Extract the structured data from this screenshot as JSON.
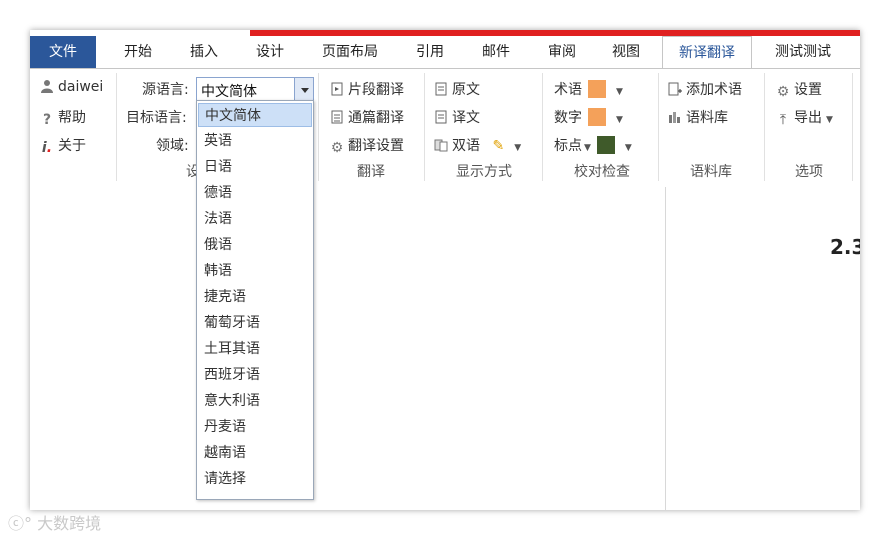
{
  "tabs": [
    "文件",
    "开始",
    "插入",
    "设计",
    "页面布局",
    "引用",
    "邮件",
    "审阅",
    "视图",
    "新译翻译",
    "测试测试"
  ],
  "user": {
    "name": "daiwei",
    "help": "帮助",
    "about": "关于"
  },
  "lang": {
    "source_label": "源语言:",
    "target_label": "目标语言:",
    "domain_label": "领域:",
    "source_value": "中文简体",
    "group_label_partial": "设",
    "options": [
      "中文简体",
      "英语",
      "日语",
      "德语",
      "法语",
      "俄语",
      "韩语",
      "捷克语",
      "葡萄牙语",
      "土耳其语",
      "西班牙语",
      "意大利语",
      "丹麦语",
      "越南语",
      "请选择"
    ]
  },
  "translate": {
    "fragment": "片段翻译",
    "full": "通篇翻译",
    "settings": "翻译设置",
    "group": "翻译"
  },
  "display": {
    "original": "原文",
    "translated": "译文",
    "bilingual": "双语",
    "group": "显示方式"
  },
  "proof": {
    "term": "术语",
    "number": "数字",
    "punct": "标点",
    "group": "校对检查",
    "colors": {
      "term": "#f4a15a",
      "number": "#f4a15a",
      "punct": "#3f5a2a"
    }
  },
  "corpus": {
    "add_term": "添加术语",
    "library": "语料库",
    "group": "语料库"
  },
  "options": {
    "settings": "设置",
    "export": "导出",
    "group": "选项"
  },
  "doc": {
    "heading": "2.3"
  },
  "watermark": "大数跨境",
  "colors": {
    "file_tab": "#2b579a",
    "accent_bar": "#e02020",
    "selected_option": "#cde0f7"
  }
}
